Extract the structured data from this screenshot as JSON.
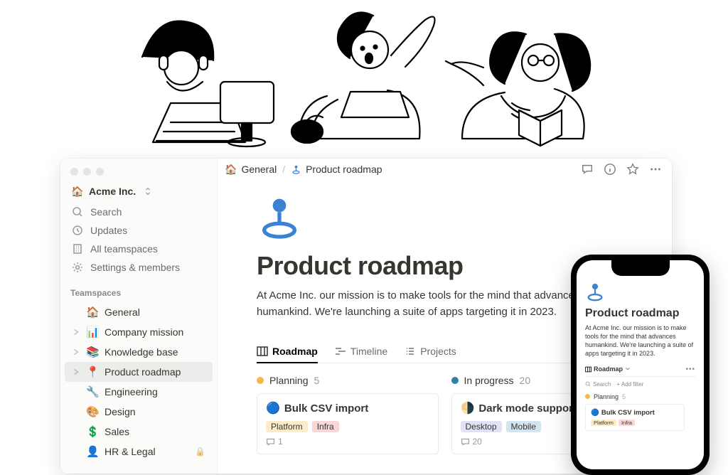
{
  "workspace": {
    "name": "Acme Inc.",
    "icon": "🏠"
  },
  "sidebar_nav": {
    "search": "Search",
    "updates": "Updates",
    "teamspaces": "All teamspaces",
    "settings": "Settings & members",
    "section_label": "Teamspaces"
  },
  "teamspaces": [
    {
      "emoji": "🏠",
      "label": "General",
      "expandable": false,
      "active": false,
      "locked": false,
      "color": "#e03e3e"
    },
    {
      "emoji": "📊",
      "label": "Company mission",
      "expandable": true,
      "active": false,
      "locked": false
    },
    {
      "emoji": "📚",
      "label": "Knowledge base",
      "expandable": true,
      "active": false,
      "locked": false
    },
    {
      "emoji": "📍",
      "label": "Product roadmap",
      "expandable": true,
      "active": true,
      "locked": false
    },
    {
      "emoji": "🔧",
      "label": "Engineering",
      "expandable": false,
      "active": false,
      "locked": false
    },
    {
      "emoji": "🎨",
      "label": "Design",
      "expandable": false,
      "active": false,
      "locked": false
    },
    {
      "emoji": "💲",
      "label": "Sales",
      "expandable": false,
      "active": false,
      "locked": false
    },
    {
      "emoji": "👤",
      "label": "HR & Legal",
      "expandable": false,
      "active": false,
      "locked": true
    }
  ],
  "breadcrumb": {
    "root_icon": "🏠",
    "root": "General",
    "page_icon": "📍",
    "page": "Product roadmap"
  },
  "page": {
    "title": "Product roadmap",
    "description": "At Acme Inc. our mission is to make tools for the mind that advances humankind. We're launching a suite of apps targeting it in 2023."
  },
  "tabs": [
    {
      "label": "Roadmap",
      "active": true
    },
    {
      "label": "Timeline",
      "active": false
    },
    {
      "label": "Projects",
      "active": false
    }
  ],
  "board": {
    "columns": [
      {
        "status": "Planning",
        "count": 5,
        "color": "#f5b945",
        "card": {
          "emoji": "🔵",
          "title": "Bulk CSV import",
          "tags": [
            {
              "text": "Platform",
              "bg": "#fdecc8"
            },
            {
              "text": "Infra",
              "bg": "#f8d7d7"
            }
          ],
          "comments": 1
        }
      },
      {
        "status": "In progress",
        "count": 20,
        "color": "#337ea9",
        "card": {
          "emoji": "🌗",
          "title": "Dark mode support",
          "tags": [
            {
              "text": "Desktop",
              "bg": "#e2e2f7"
            },
            {
              "text": "Mobile",
              "bg": "#d3e5ef"
            }
          ],
          "comments": 20
        }
      }
    ]
  },
  "phone": {
    "title": "Product roadmap",
    "description": "At Acme Inc. our mission is to make tools for the mind that advances humankind. We're launching a suite of apps targeting it in 2023.",
    "tab": "Roadmap",
    "search": "Search",
    "filter": "+ Add filter",
    "column": {
      "status": "Planning",
      "count": 5,
      "color": "#f5b945"
    },
    "card": {
      "emoji": "🔵",
      "title": "Bulk CSV import",
      "tags": [
        {
          "text": "Platform",
          "bg": "#fdecc8"
        },
        {
          "text": "Infra",
          "bg": "#f8d7d7"
        }
      ]
    }
  },
  "colors": {
    "blue": "#3b82d4",
    "red": "#e03e3e"
  }
}
